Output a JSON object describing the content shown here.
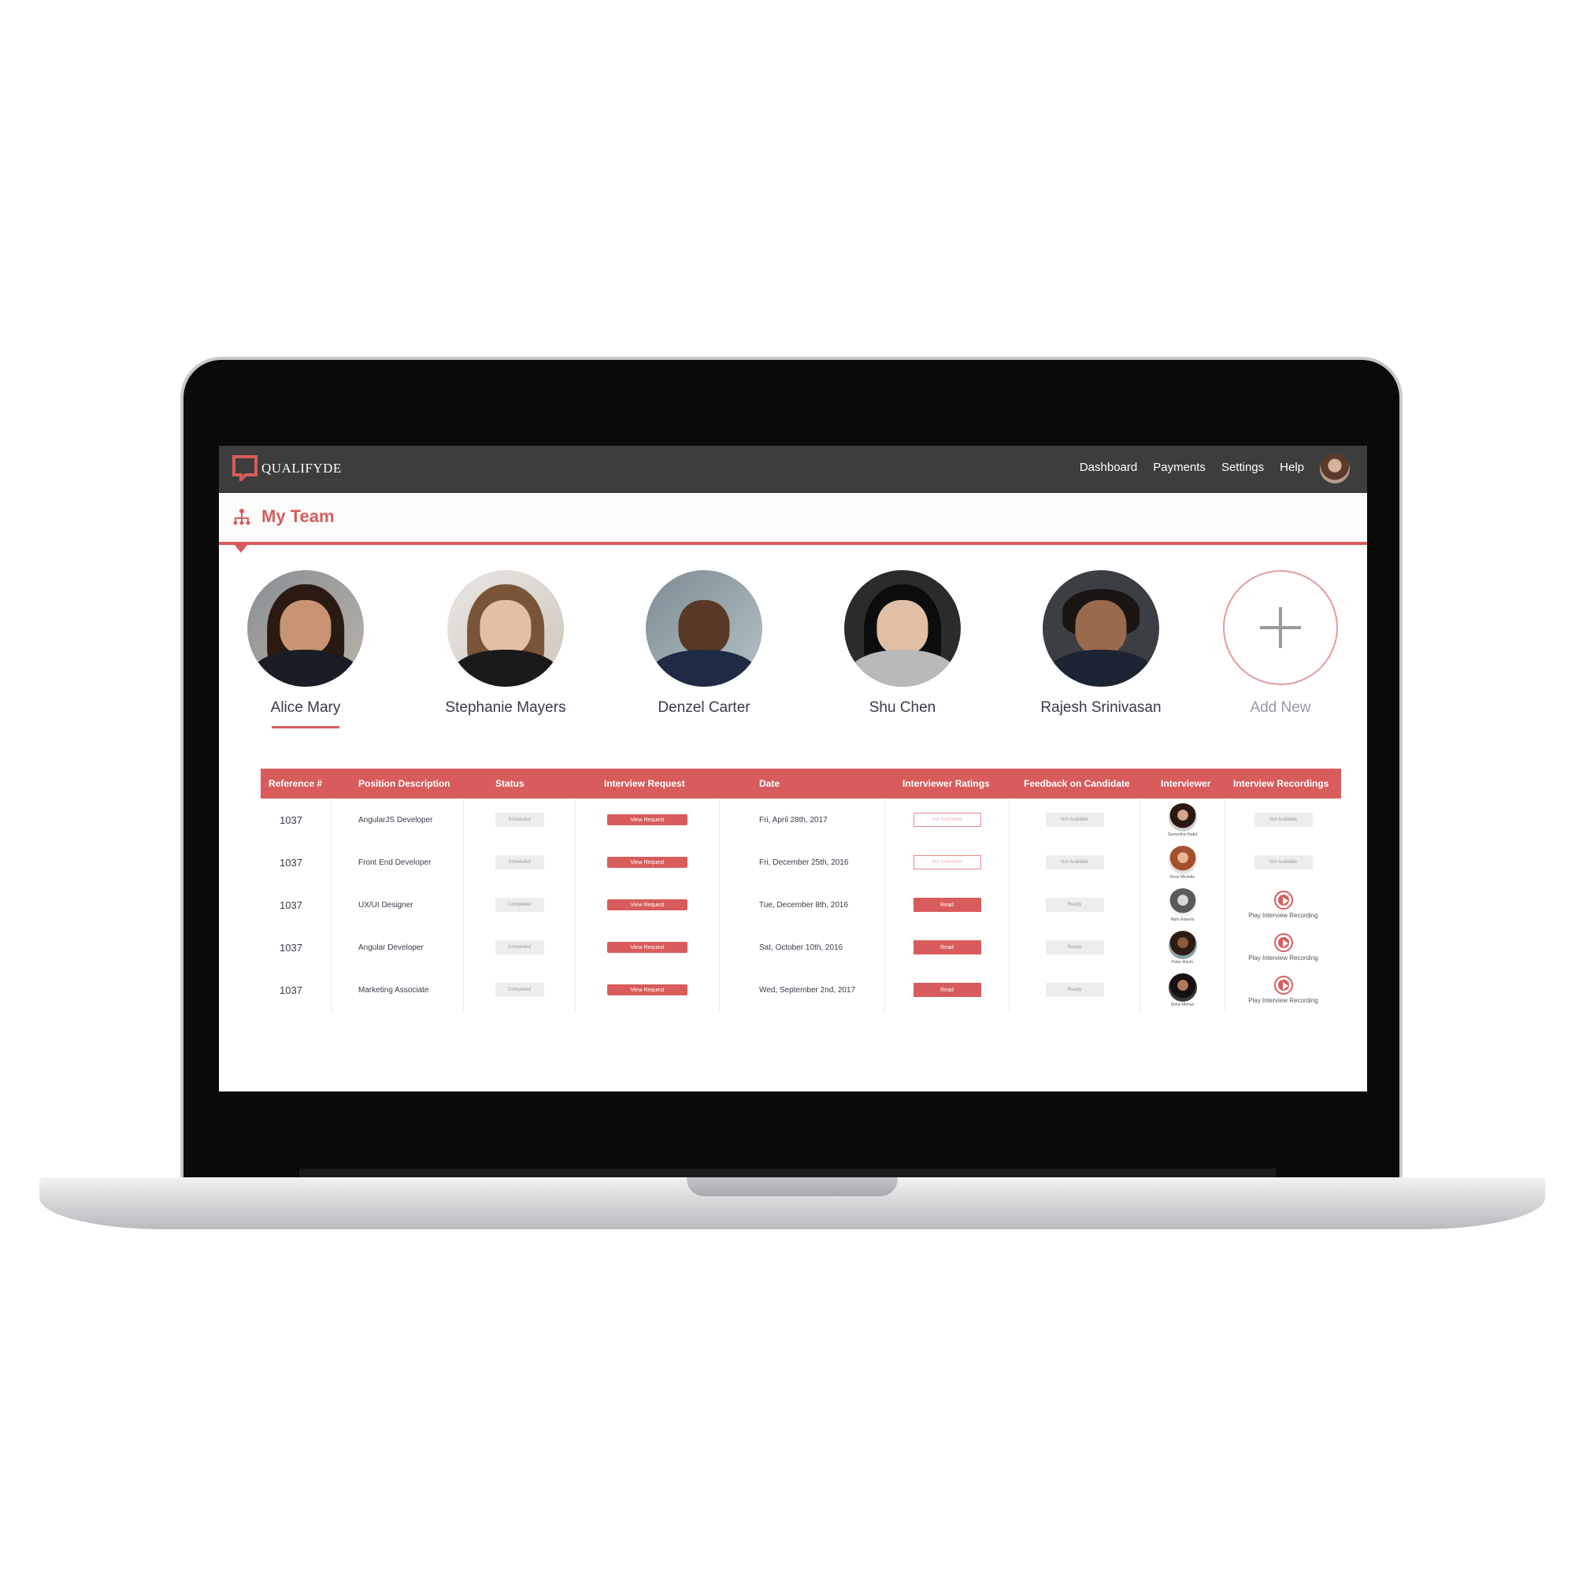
{
  "app": {
    "brand": "QUALIFYDE"
  },
  "nav": {
    "items": [
      "Dashboard",
      "Payments",
      "Settings",
      "Help"
    ]
  },
  "page": {
    "title": "My Team"
  },
  "team": {
    "members": [
      {
        "name": "Alice Mary",
        "selected": true
      },
      {
        "name": "Stephanie Mayers"
      },
      {
        "name": "Denzel Carter"
      },
      {
        "name": "Shu Chen"
      },
      {
        "name": "Rajesh Srinivasan"
      }
    ],
    "add_label": "Add New"
  },
  "table": {
    "headers": [
      "Reference #",
      "Position Description",
      "Status",
      "Interview Request",
      "Date",
      "Interviewer Ratings",
      "Feedback on Candidate",
      "Interviewer",
      "Interview Recordings"
    ],
    "rows": [
      {
        "ref": "1037",
        "position": "AngularJS Developer",
        "status": "Scheduled",
        "request": "View Request",
        "date": "Fri, April 28th, 2017",
        "rating": "Not Submitted",
        "feedback": "Not Available",
        "interviewer": "Samantha Hadid",
        "recording": "Not Available"
      },
      {
        "ref": "1037",
        "position": "Front End Developer",
        "status": "Scheduled",
        "request": "View Request",
        "date": "Fri, December 25th, 2016",
        "rating": "Not Submitted",
        "feedback": "Not Available",
        "interviewer": "Rose Michelle",
        "recording": "Not Available"
      },
      {
        "ref": "1037",
        "position": "UX/UI Designer",
        "status": "Completed",
        "request": "View Request",
        "date": "Tue, December 8th, 2016",
        "rating": "Read",
        "feedback": "Ready",
        "interviewer": "Mark Roberts",
        "recording": "Play Interview Recording"
      },
      {
        "ref": "1037",
        "position": "Angular Developer",
        "status": "Completed",
        "request": "View Request",
        "date": "Sat, October 10th, 2016",
        "rating": "Read",
        "feedback": "Ready",
        "interviewer": "Peter Marsh",
        "recording": "Play Interview Recording"
      },
      {
        "ref": "1037",
        "position": "Marketing Associate",
        "status": "Completed",
        "request": "View Request",
        "date": "Wed, September 2nd, 2017",
        "rating": "Read",
        "feedback": "Ready",
        "interviewer": "Shruti Mohan",
        "recording": "Play Interview Recording"
      }
    ]
  },
  "colors": {
    "accent": "#d85c5c",
    "header_bg": "#3d3d3d"
  },
  "icons": {
    "logo": "qualifyde-logo-icon",
    "team": "org-chart-icon",
    "add": "plus-icon",
    "play": "play-circle-icon"
  }
}
